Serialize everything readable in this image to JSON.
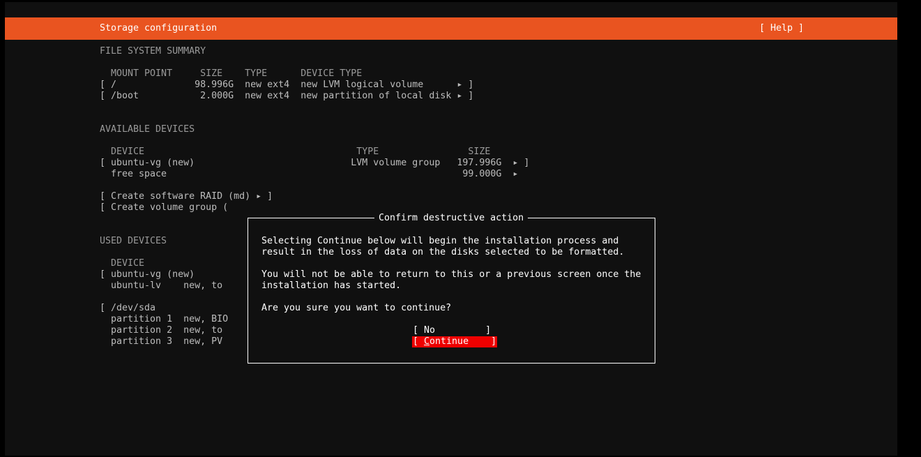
{
  "header": {
    "title": "Storage configuration",
    "help": "[ Help ]"
  },
  "fs_summary": {
    "heading": "FILE SYSTEM SUMMARY",
    "columns_line": "  MOUNT POINT     SIZE    TYPE      DEVICE TYPE",
    "rows": [
      "[ /              98.996G  new ext4  new LVM logical volume      ▸ ]",
      "[ /boot           2.000G  new ext4  new partition of local disk ▸ ]"
    ]
  },
  "available": {
    "heading": "AVAILABLE DEVICES",
    "columns_line": "  DEVICE                                      TYPE                SIZE",
    "rows": [
      "[ ubuntu-vg (new)                            LVM volume group   197.996G  ▸ ]",
      "  free space                                                     99.000G  ▸"
    ],
    "actions": [
      "[ Create software RAID (md) ▸ ]",
      "[ Create volume group ("
    ]
  },
  "used": {
    "heading": "USED DEVICES",
    "lines": [
      "  DEVICE",
      "[ ubuntu-vg (new)",
      "  ubuntu-lv    new, to",
      "",
      "[ /dev/sda",
      "  partition 1  new, BIO",
      "  partition 2  new, to",
      "  partition 3  new, PV"
    ]
  },
  "dialog": {
    "title": "Confirm destructive action",
    "paragraph1": [
      "Selecting Continue below will begin the installation process and",
      "result in the loss of data on the disks selected to be formatted."
    ],
    "paragraph2": [
      "You will not be able to return to this or a previous screen once the",
      "installation has started."
    ],
    "question": "Are you sure you want to continue?",
    "buttons": {
      "no": "[ No         ]",
      "continue_open": "[ ",
      "continue_hotkey": "C",
      "continue_rest": "ontinue    ]"
    }
  }
}
